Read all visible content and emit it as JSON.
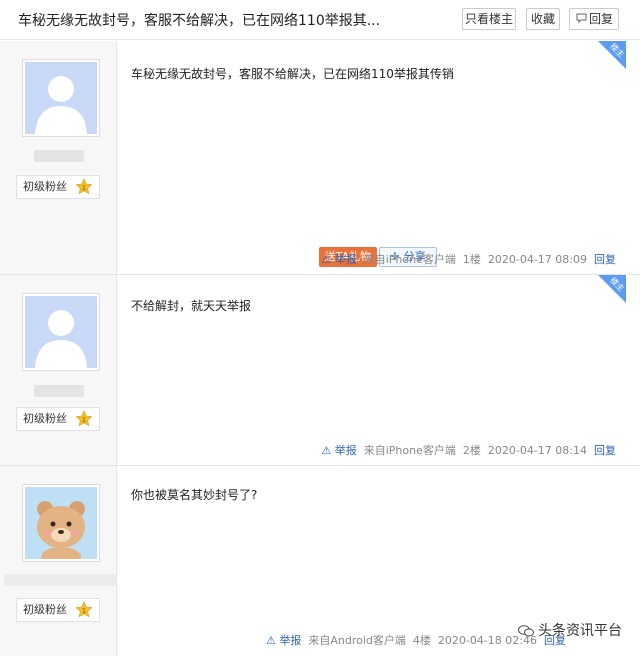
{
  "thread": {
    "title": "车秘无缘无故封号，客服不给解决，已在网络110举报其..."
  },
  "toolbar": {
    "only_op_label": "只看楼主",
    "favorite_label": "收藏",
    "reply_label": "回复"
  },
  "posts": [
    {
      "op_badge": "楼主",
      "level_label": "初级粉丝",
      "content": "车秘无缘无故封号，客服不给解决，已在网络110举报其传销",
      "gift_label": "送TA礼物",
      "share_label": "分享",
      "report_label": "举报",
      "source": "来自iPhone客户端",
      "floor": "1楼",
      "time": "2020-04-17 08:09",
      "reply_label": "回复"
    },
    {
      "op_badge": "楼主",
      "level_label": "初级粉丝",
      "content": "不给解封，就天天举报",
      "report_label": "举报",
      "source": "来自iPhone客户端",
      "floor": "2楼",
      "time": "2020-04-17 08:14",
      "reply_label": "回复"
    },
    {
      "level_label": "初级粉丝",
      "content": "你也被莫名其妙封号了?",
      "report_label": "举报",
      "source": "来自Android客户端",
      "floor": "4楼",
      "time": "2020-04-18 02:46",
      "reply_label": "回复"
    }
  ],
  "watermark": "头条资讯平台",
  "colors": {
    "accent_blue": "#2d64b3",
    "gift_orange": "#e9723b",
    "op_badge_blue": "#5b9cf2"
  }
}
